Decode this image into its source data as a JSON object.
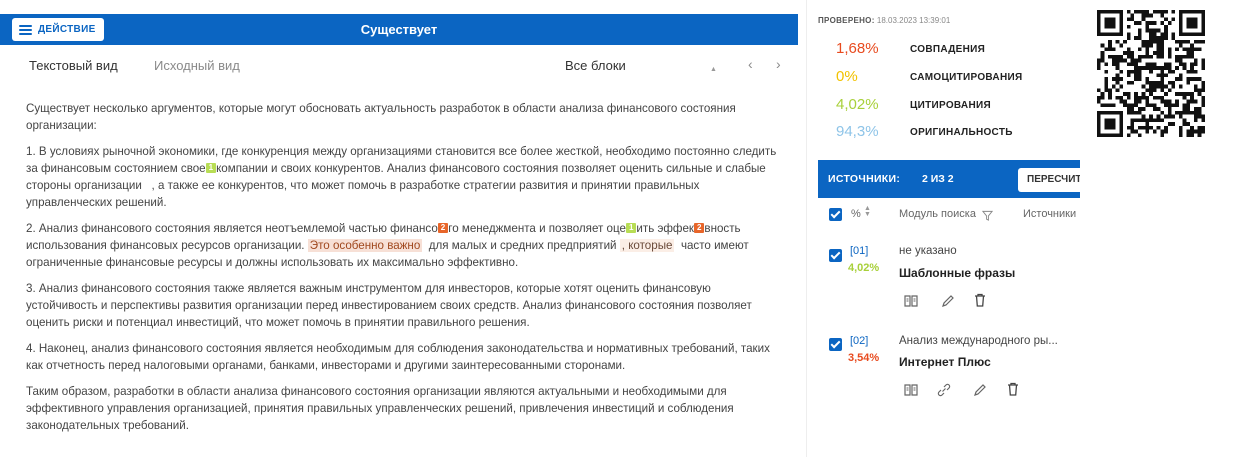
{
  "header": {
    "action_label": "ДЕЙСТВИЕ",
    "title": "Существует"
  },
  "tabs": {
    "text_view": "Текстовый вид",
    "source_view": "Исходный вид",
    "all_blocks": "Все блоки"
  },
  "document": {
    "p1": "Существует несколько аргументов, которые могут обосновать актуальность разработок в области анализа финансового состояния организации:",
    "p2a": "1. В условиях рыночной экономики, где конкуренция между организациями становится все более жесткой, необходимо постоянно следить за финансовым состоянием свое",
    "p2b": "компании и своих конкурентов. Анализ финансового состояния позволяет оценить сильные и слабые стороны организации",
    "p2c": ", а также ее конкурентов, что может помочь в разработке стратегии развития и принятии правильных управленческих решений.",
    "p3a": "2. Анализ финансового состояния является неотъемлемой частью финансо",
    "p3b": "го менеджмента и позволяет оце",
    "p3c": "ить эффек",
    "p3d": "вность использования финансовых ресурсов организации.",
    "p3e": "Это особенно важно",
    "p3f": "для малых и средних предприятий",
    "p3g": ", которые",
    "p3h": "часто имеют ограниченные финансовые ресурсы и должны использовать их максимально эффективно.",
    "p4": "3. Анализ финансового состояния также является важным инструментом для инвесторов, которые хотят оценить финансовую устойчивость и перспективы развития организации перед инвестированием своих средств. Анализ финансового состояния позволяет оценить риски и потенциал инвестиций, что может помочь в принятии правильного решения.",
    "p5": "4. Наконец, анализ финансового состояния является необходимым для соблюдения законодательства и нормативных требований, таких как отчетность перед налоговыми органами, банками, инвесторами и другими заинтересованными сторонами.",
    "p6": "Таким образом, разработки в области анализа финансового состояния организации являются актуальными и необходимыми для эффективного управления организацией, принятия правильных управленческих решений, привлечения инвестиций и соблюдения законодательных требований.",
    "marker_1": "1",
    "marker_2": "2"
  },
  "report": {
    "checked_label": "ПРОВЕРЕНО:",
    "checked_date": "18.03.2023 13:39:01",
    "stats": [
      {
        "value": "1,68%",
        "label": "СОВПАДЕНИЯ",
        "color": "#e84b1f"
      },
      {
        "value": "0%",
        "label": "САМОЦИТИРОВАНИЯ",
        "color": "#f2c200"
      },
      {
        "value": "4,02%",
        "label": "ЦИТИРОВАНИЯ",
        "color": "#a8d03a"
      },
      {
        "value": "94,3%",
        "label": "ОРИГИНАЛЬНОСТЬ",
        "color": "#8ec4e8"
      }
    ]
  },
  "sources": {
    "title": "ИСТОЧНИКИ:",
    "count": "2 ИЗ 2",
    "recalc_label": "ПЕРЕСЧИТАТЬ",
    "col_pct": "%",
    "col_module": "Модуль поиска",
    "col_sources": "Источники",
    "rows": [
      {
        "id": "[01]",
        "pct": "4,02%",
        "pct_color": "#a8d03a",
        "module": "не указано",
        "type": "Шаблонные фразы"
      },
      {
        "id": "[02]",
        "pct": "3,54%",
        "pct_color": "#e84b1f",
        "module": "Анализ международного ры...",
        "type": "Интернет Плюс"
      }
    ]
  }
}
